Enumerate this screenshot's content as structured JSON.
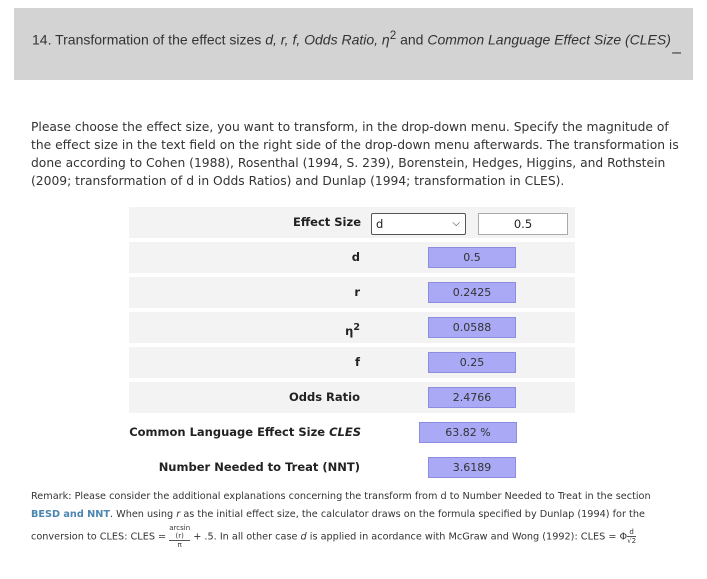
{
  "header": {
    "title_prefix": "14. Transformation of the effect sizes ",
    "title_vars": "d, r, f, Odds Ratio, η",
    "title_sup": "2",
    "title_and": " and ",
    "title_cles": "Common Language Effect Size (CLES)",
    "collapse_symbol": "–"
  },
  "intro": "Please choose the effect size, you want to transform, in the drop-down menu. Specify the magnitude of the effect size in the text field on the right side of the drop-down menu afterwards. The transformation is done according to Cohen (1988), Rosenthal (1994, S. 239), Borenstein, Hedges, Higgins, and Rothstein (2009; transformation of d in Odds Ratios) and Dunlap (1994; transformation in CLES).",
  "calculator": {
    "effect_size_label": "Effect Size",
    "select_value": "d",
    "input_value": "0.5",
    "rows": [
      {
        "label": "d",
        "value": "0.5"
      },
      {
        "label": "r",
        "value": "0.2425"
      },
      {
        "label": "η",
        "sup": "2",
        "value": "0.0588"
      },
      {
        "label": "f",
        "value": "0.25"
      },
      {
        "label": "Odds Ratio",
        "value": "2.4766"
      },
      {
        "label": "Common Language Effect Size ",
        "label_italic": "CLES",
        "value": "63.82 %"
      },
      {
        "label": "Number Needed to Treat (NNT)",
        "value": "3.6189"
      }
    ]
  },
  "remark": {
    "p1": "Remark: Please consider the additional explanations concerning the transform from d to Number Needed to Treat in the section ",
    "link": "BESD and NNT",
    "p2": ". When using ",
    "r": "r",
    "p3": " as the initial effect size, the calculator draws on the formula specified by Dunlap (1994) for the conversion to CLES: CLES = ",
    "frac_top": "arcsin",
    "frac_mid": "(r)",
    "frac_bot": "π",
    "p4": " + .5. In all other case ",
    "d": "d",
    "p5": " is applied in acordance with McGraw and Wong (1992): CLES = Φ",
    "frac2_top": "d",
    "frac2_bot": "√2"
  }
}
